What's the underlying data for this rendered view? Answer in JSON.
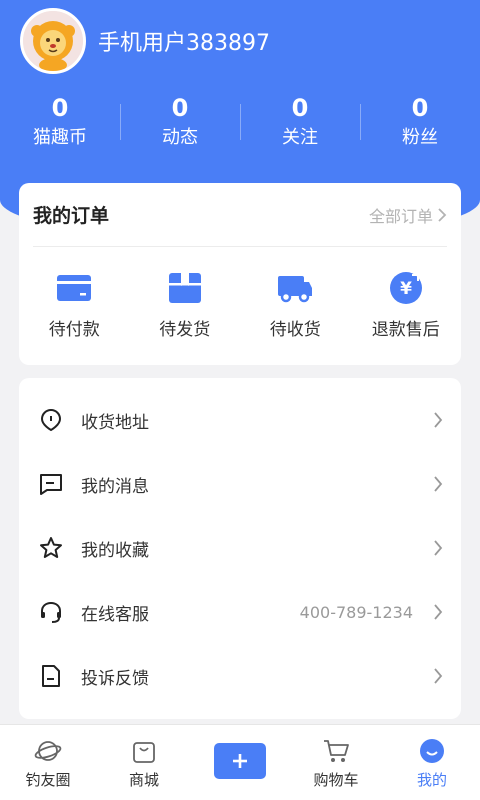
{
  "colors": {
    "primary": "#4a7ef6",
    "background": "#f2f2f4",
    "card": "#ffffff"
  },
  "profile": {
    "username": "手机用户383897",
    "avatar_icon": "lion-avatar"
  },
  "stats": [
    {
      "value": "0",
      "label": "猫趣币"
    },
    {
      "value": "0",
      "label": "动态"
    },
    {
      "value": "0",
      "label": "关注"
    },
    {
      "value": "0",
      "label": "粉丝"
    }
  ],
  "orders": {
    "title": "我的订单",
    "all_label": "全部订单",
    "items": [
      {
        "label": "待付款",
        "icon": "wallet-card-icon"
      },
      {
        "label": "待发货",
        "icon": "package-box-icon"
      },
      {
        "label": "待收货",
        "icon": "delivery-truck-icon"
      },
      {
        "label": "退款售后",
        "icon": "yuan-refund-icon"
      }
    ]
  },
  "menu": [
    {
      "label": "收货地址",
      "icon": "location-pin-icon",
      "value": ""
    },
    {
      "label": "我的消息",
      "icon": "message-icon",
      "value": ""
    },
    {
      "label": "我的收藏",
      "icon": "star-icon",
      "value": ""
    },
    {
      "label": "在线客服",
      "icon": "headset-icon",
      "value": "400-789-1234"
    },
    {
      "label": "投诉反馈",
      "icon": "document-icon",
      "value": ""
    }
  ],
  "tabbar": [
    {
      "label": "钓友圈",
      "icon": "planet-icon"
    },
    {
      "label": "商城",
      "icon": "shopping-bag-icon"
    },
    {
      "label": "",
      "icon": "plus-icon"
    },
    {
      "label": "购物车",
      "icon": "cart-icon"
    },
    {
      "label": "我的",
      "icon": "smile-face-icon",
      "active": true
    }
  ]
}
